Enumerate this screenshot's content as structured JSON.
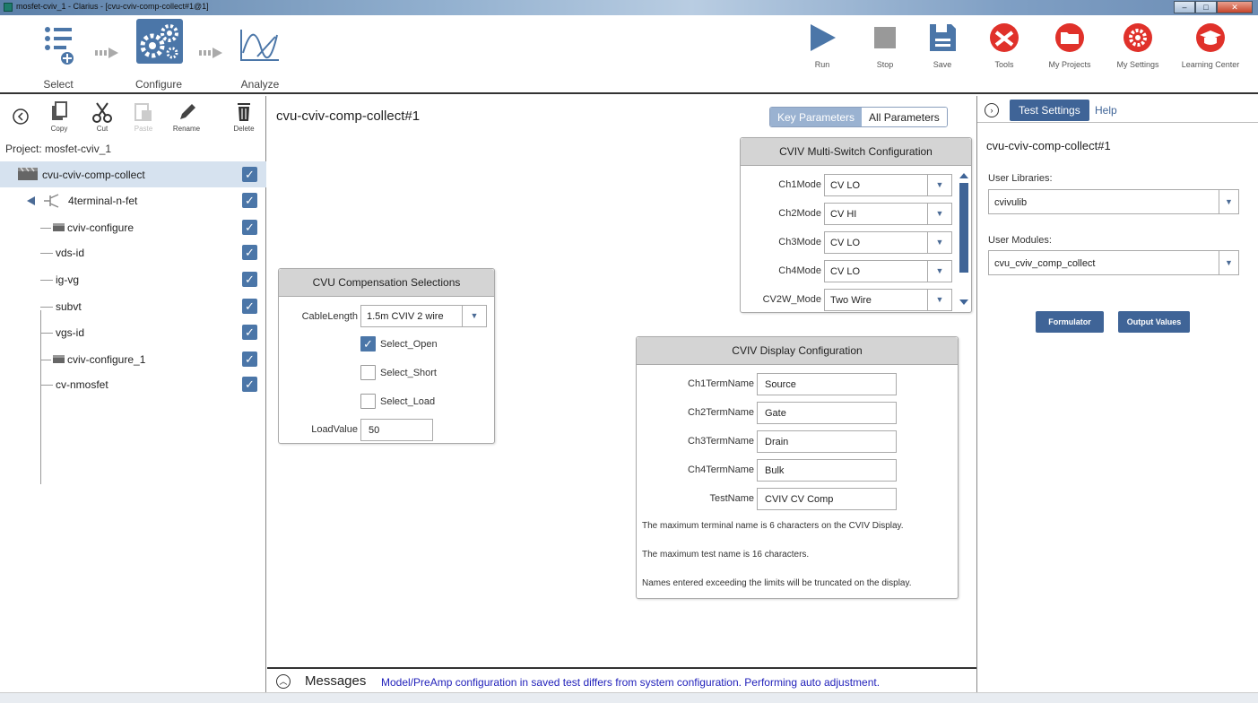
{
  "window": {
    "title": "mosfet-cviv_1 - Clarius - [cvu-cviv-comp-collect#1@1]",
    "controls": {
      "minimize": "–",
      "maximize": "□",
      "close": "✕"
    }
  },
  "workflow": {
    "steps": [
      {
        "label": "Select",
        "icon": "select-list-icon"
      },
      {
        "label": "Configure",
        "icon": "configure-gears-icon",
        "active": true
      },
      {
        "label": "Analyze",
        "icon": "analyze-graph-icon"
      }
    ]
  },
  "toolbar_right": {
    "run": "Run",
    "stop": "Stop",
    "save": "Save",
    "tools": "Tools",
    "my_projects": "My Projects",
    "my_settings": "My Settings",
    "learning_center": "Learning Center"
  },
  "colors": {
    "accent": "#3f6497",
    "red": "#e0312a",
    "selected_row": "#d6e2ef",
    "message_text": "#2222bb"
  },
  "left_tools": {
    "copy": "Copy",
    "cut": "Cut",
    "paste": "Paste",
    "rename": "Rename",
    "delete": "Delete"
  },
  "project": {
    "label": "Project: mosfet-cviv_1",
    "tree": [
      {
        "label": "cvu-cviv-comp-collect",
        "checked": true,
        "selected": true
      },
      {
        "label": "4terminal-n-fet",
        "checked": true
      },
      {
        "label": "cviv-configure",
        "checked": true
      },
      {
        "label": "vds-id",
        "checked": true
      },
      {
        "label": "ig-vg",
        "checked": true
      },
      {
        "label": "subvt",
        "checked": true
      },
      {
        "label": "vgs-id",
        "checked": true
      },
      {
        "label": "cviv-configure_1",
        "checked": true
      },
      {
        "label": "cv-nmosfet",
        "checked": true
      }
    ]
  },
  "main": {
    "title": "cvu-cviv-comp-collect#1",
    "tabs": {
      "key": "Key Parameters",
      "all": "All Parameters"
    }
  },
  "cvu_panel": {
    "title": "CVU Compensation Selections",
    "cable_length_label": "CableLength",
    "cable_length_value": "1.5m CVIV 2 wire",
    "select_open": "Select_Open",
    "select_open_checked": true,
    "select_short": "Select_Short",
    "select_short_checked": false,
    "select_load": "Select_Load",
    "select_load_checked": false,
    "load_value_label": "LoadValue",
    "load_value": "50"
  },
  "switch_panel": {
    "title": "CVIV Multi-Switch Configuration",
    "rows": [
      {
        "label": "Ch1Mode",
        "value": "CV LO"
      },
      {
        "label": "Ch2Mode",
        "value": "CV HI"
      },
      {
        "label": "Ch3Mode",
        "value": "CV LO"
      },
      {
        "label": "Ch4Mode",
        "value": "CV LO"
      },
      {
        "label": "CV2W_Mode",
        "value": "Two Wire"
      }
    ]
  },
  "display_panel": {
    "title": "CVIV Display Configuration",
    "rows": [
      {
        "label": "Ch1TermName",
        "value": "Source"
      },
      {
        "label": "Ch2TermName",
        "value": "Gate"
      },
      {
        "label": "Ch3TermName",
        "value": "Drain"
      },
      {
        "label": "Ch4TermName",
        "value": "Bulk"
      },
      {
        "label": "TestName",
        "value": "CVIV CV Comp"
      }
    ],
    "notes": [
      "The maximum terminal name is 6 characters on the CVIV Display.",
      "The maximum test name is 16 characters.",
      "Names entered exceeding the limits will be truncated on the display."
    ]
  },
  "messages": {
    "title": "Messages",
    "text": "Model/PreAmp configuration in saved test differs from system configuration. Performing auto adjustment."
  },
  "right_panel": {
    "tab_active": "Test Settings",
    "tab_help": "Help",
    "title": "cvu-cviv-comp-collect#1",
    "user_libraries_label": "User Libraries:",
    "user_libraries_value": "cvivulib",
    "user_modules_label": "User Modules:",
    "user_modules_value": "cvu_cviv_comp_collect",
    "formulator": "Formulator",
    "output_values": "Output Values"
  }
}
